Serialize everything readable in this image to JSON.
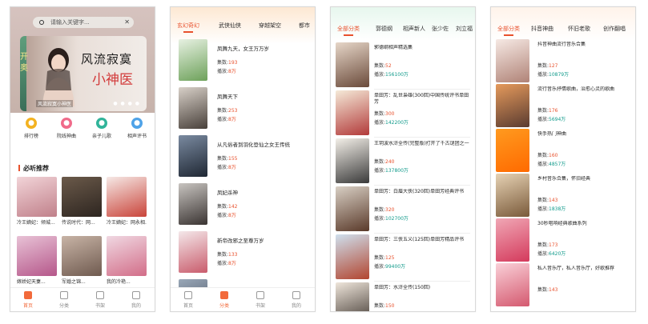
{
  "screen1": {
    "search_placeholder": "请输入关键字...",
    "banner": {
      "title_line1": "风流寂寞",
      "title_line2": "小神医",
      "side_text": "开奥",
      "caption": "风流寂寞小神医"
    },
    "quick_links": [
      {
        "label": "排行榜",
        "icon": "trophy-icon",
        "color": "#f3b221"
      },
      {
        "label": "院线神曲",
        "icon": "ribbon-icon",
        "color": "#f06b8a"
      },
      {
        "label": "亲子儿歌",
        "icon": "child-icon",
        "color": "#31b49a"
      },
      {
        "label": "相声评书",
        "icon": "check-icon",
        "color": "#4fa3e8"
      }
    ],
    "section_title": "必听推荐",
    "recommendations": [
      {
        "name": "冷王嫡妃：倾城...",
        "colors": [
          "#f2d4d8",
          "#c0808a"
        ]
      },
      {
        "name": "传说时代：网...",
        "colors": [
          "#6b5a4a",
          "#2d2520"
        ]
      },
      {
        "name": "冷王嫡妃：网永相...",
        "colors": [
          "#f6e9e6",
          "#c9443a"
        ]
      },
      {
        "name": "嫁娇妃天妻...",
        "colors": [
          "#e8c2d6",
          "#b5578a"
        ]
      },
      {
        "name": "军婚之锦...",
        "colors": [
          "#c8b4a6",
          "#6f5a4f"
        ]
      },
      {
        "name": "我的冷艳...",
        "colors": [
          "#f0d8e2",
          "#d26d88"
        ]
      }
    ]
  },
  "screen2": {
    "tabs": [
      "玄幻奇幻",
      "武侠仙侠",
      "穿越架空",
      "都市"
    ],
    "books": [
      {
        "title": "凤舞九天，女王万万岁",
        "play_label": "集数:",
        "play": "193",
        "plays_label": "播放:",
        "plays": "8万",
        "colors": [
          "#e7f1e2",
          "#6da15a"
        ]
      },
      {
        "title": "凤舞天下",
        "play_label": "集数:",
        "play": "253",
        "plays_label": "播放:",
        "plays": "8万",
        "colors": [
          "#d8d0c8",
          "#48403a"
        ]
      },
      {
        "title": "从凡俗者到羽化登仙之女王传统",
        "play_label": "集数:",
        "play": "155",
        "plays_label": "播放:",
        "plays": "8万",
        "colors": [
          "#7a8aa0",
          "#1f2733"
        ]
      },
      {
        "title": "凤妃杀神",
        "play_label": "集数:",
        "play": "142",
        "plays_label": "播放:",
        "plays": "8万",
        "colors": [
          "#c8c4c0",
          "#3a3432"
        ]
      },
      {
        "title": "新帝改邪之至尊万岁",
        "play_label": "集数:",
        "play": "133",
        "plays_label": "播放:",
        "plays": "8万",
        "colors": [
          "#f4e8ea",
          "#c95c6c"
        ]
      },
      {
        "title": "",
        "play_label": "",
        "play": "",
        "plays_label": "",
        "plays": "",
        "colors": [
          "#9aa8b8",
          "#3d4656"
        ]
      }
    ]
  },
  "screen3": {
    "tabs": [
      "全部分类",
      "郭德纲",
      "相声新人",
      "张少佐",
      "刘立福"
    ],
    "items": [
      {
        "title": "郭德纲相声精选集",
        "ep_label": "集数:",
        "ep": "52",
        "play_label": "播放:",
        "play": "156100万",
        "colors": [
          "#e6d6c8",
          "#6a4a3a"
        ]
      },
      {
        "title": "单田芳：乱世枭雄(300回)中国传统评书单田芳",
        "ep_label": "集数:",
        "ep": "300",
        "play_label": "播放:",
        "play": "142200万",
        "colors": [
          "#f5ead8",
          "#b23a3a"
        ]
      },
      {
        "title": "王玥波水浒全传(完整版)打开了千古谜团之一",
        "ep_label": "集数:",
        "ep": "240",
        "play_label": "播放:",
        "play": "137800万",
        "colors": [
          "#f3efe8",
          "#3a3a3a"
        ]
      },
      {
        "title": "单田芳：白眉大侠(320回)单田芳经典评书",
        "ep_label": "集数:",
        "ep": "320",
        "play_label": "播放:",
        "play": "102700万",
        "colors": [
          "#d8cfc4",
          "#5a3a2a"
        ]
      },
      {
        "title": "单田芳：三侠五义(125回)单田芳精品评书",
        "ep_label": "集数:",
        "ep": "125",
        "play_label": "播放:",
        "play": "99400万",
        "colors": [
          "#cfe0ee",
          "#b2452f"
        ]
      },
      {
        "title": "单田芳：水浒全传(150回)",
        "ep_label": "集数:",
        "ep": "150",
        "play_label": "",
        "play": "",
        "colors": [
          "#efe6db",
          "#352c26"
        ]
      }
    ]
  },
  "screen4": {
    "tabs": [
      "全部分类",
      "抖音神曲",
      "怀旧老歌",
      "创作翻唱"
    ],
    "items": [
      {
        "title": "抖音神曲流行音乐合集",
        "ep_label": "集数:",
        "ep": "127",
        "play_label": "播放:",
        "play": "10879万",
        "colors": [
          "#f6e9e4",
          "#b08377"
        ]
      },
      {
        "title": "流行音乐抒情歌曲，治愈心灵的歌曲",
        "ep_label": "集数:",
        "ep": "176",
        "play_label": "播放:",
        "play": "5694万",
        "colors": [
          "#e59a5c",
          "#5a3b30"
        ]
      },
      {
        "title": "快手热门神曲",
        "ep_label": "集数:",
        "ep": "160",
        "play_label": "播放:",
        "play": "4857万",
        "colors": [
          "#ff9a1f",
          "#ff6a00"
        ]
      },
      {
        "title": "乡村音乐合集，怀旧经典",
        "ep_label": "集数:",
        "ep": "143",
        "play_label": "播放:",
        "play": "1838万",
        "colors": [
          "#e6d2b4",
          "#7a5a3a"
        ]
      },
      {
        "title": "30秒唱响经典歌曲系列",
        "ep_label": "集数:",
        "ep": "173",
        "play_label": "播放:",
        "play": "6420万",
        "colors": [
          "#f0a7b5",
          "#d43a5c"
        ]
      },
      {
        "title": "私人音乐厅，私人音乐厅，好歌推荐",
        "ep_label": "集数:",
        "ep": "143",
        "play_label": "",
        "play": "",
        "colors": [
          "#fad0d8",
          "#d4596f"
        ]
      }
    ]
  },
  "tabbar": {
    "items": [
      {
        "label": "首页",
        "icon": "home-icon"
      },
      {
        "label": "分类",
        "icon": "category-icon"
      },
      {
        "label": "书架",
        "icon": "bookshelf-icon"
      },
      {
        "label": "我的",
        "icon": "profile-icon"
      }
    ],
    "active_color": "#f26a3b"
  },
  "colors": {
    "accent": "#e8512d",
    "teal": "#0f9a8a"
  }
}
